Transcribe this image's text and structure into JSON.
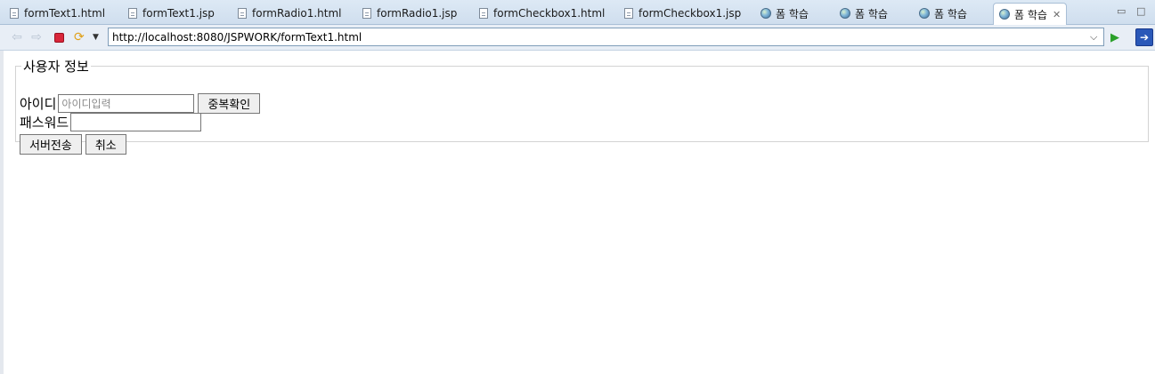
{
  "tabs": [
    {
      "label": "formText1.html",
      "icon": "file-icon"
    },
    {
      "label": "formText1.jsp",
      "icon": "file-icon"
    },
    {
      "label": "formRadio1.html",
      "icon": "file-icon"
    },
    {
      "label": "formRadio1.jsp",
      "icon": "file-icon"
    },
    {
      "label": "formCheckbox1.html",
      "icon": "file-icon"
    },
    {
      "label": "formCheckbox1.jsp",
      "icon": "file-icon"
    },
    {
      "label": "폼 학습",
      "icon": "globe-icon"
    },
    {
      "label": "폼 학습",
      "icon": "globe-icon"
    },
    {
      "label": "폼 학습",
      "icon": "globe-icon"
    },
    {
      "label": "폼 학습",
      "icon": "globe-icon",
      "active": true
    }
  ],
  "toolbar": {
    "url": "http://localhost:8080/JSPWORK/formText1.html"
  },
  "form": {
    "legend": "사용자 정보",
    "id_label": "아이디",
    "id_placeholder": "아이디입력",
    "id_value": "",
    "check_button": "중복확인",
    "password_label": "패스워드",
    "password_value": "",
    "submit_button": "서버전송",
    "cancel_button": "취소"
  },
  "colors": {
    "tabbar_bg": "#dde9f5",
    "toolbar_bg": "#e8eef6",
    "stop_red": "#d9263a",
    "go_green": "#2aa02a"
  }
}
